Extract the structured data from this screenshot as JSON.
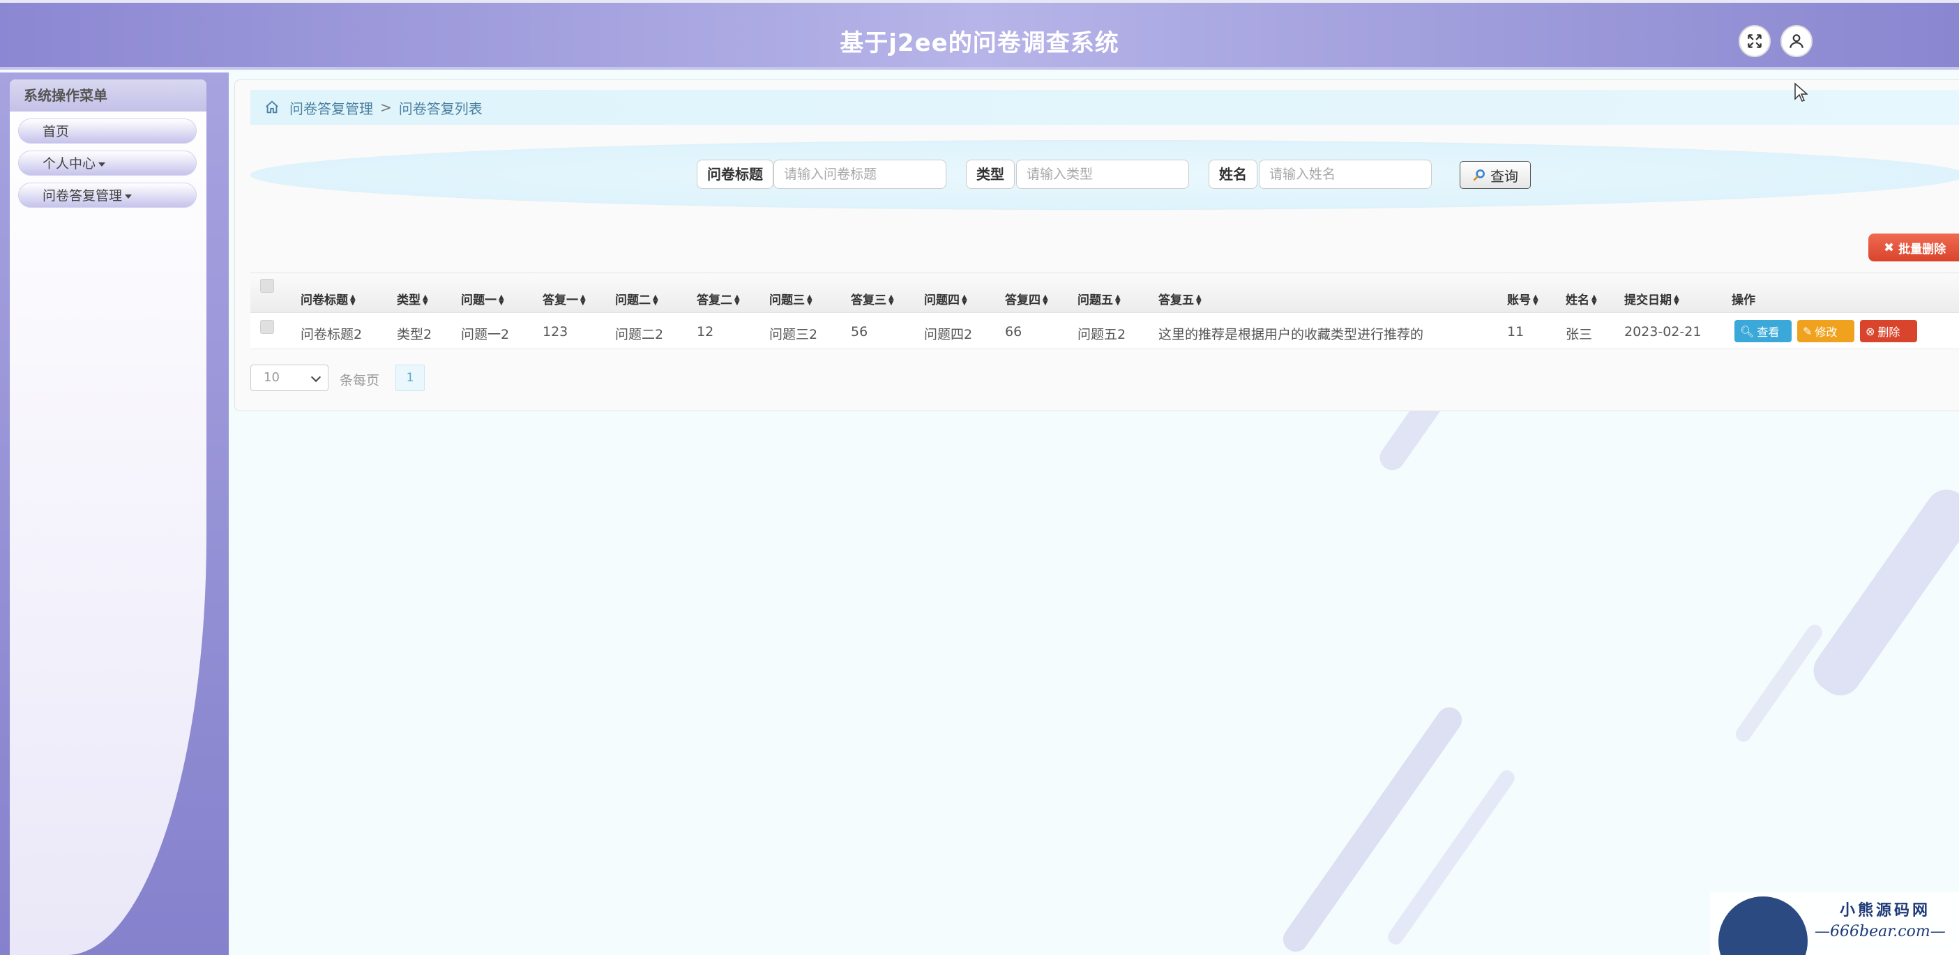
{
  "header": {
    "title": "基于j2ee的问卷调查系统"
  },
  "sidebar": {
    "title": "系统操作菜单",
    "items": [
      {
        "label": "首页",
        "has_caret": false
      },
      {
        "label": "个人中心",
        "has_caret": true
      },
      {
        "label": "问卷答复管理",
        "has_caret": true
      }
    ]
  },
  "breadcrumb": {
    "parent": "问卷答复管理",
    "separator": ">",
    "current": "问卷答复列表"
  },
  "search": {
    "title_label": "问卷标题",
    "title_placeholder": "请输入问卷标题",
    "type_label": "类型",
    "type_placeholder": "请输入类型",
    "name_label": "姓名",
    "name_placeholder": "请输入姓名",
    "query_label": "查询"
  },
  "actions": {
    "batch_delete_label": "批量删除"
  },
  "table": {
    "headers": [
      "问卷标题",
      "类型",
      "问题一",
      "答复一",
      "问题二",
      "答复二",
      "问题三",
      "答复三",
      "问题四",
      "答复四",
      "问题五",
      "答复五",
      "账号",
      "姓名",
      "提交日期",
      "操作"
    ],
    "rows": [
      {
        "cells": [
          "问卷标题2",
          "类型2",
          "问题一2",
          "123",
          "问题二2",
          "12",
          "问题三2",
          "56",
          "问题四2",
          "66",
          "问题五2",
          "这里的推荐是根据用户的收藏类型进行推荐的",
          "11",
          "张三",
          "2023-02-21"
        ],
        "view_label": "查看",
        "edit_label": "修改",
        "delete_label": "删除"
      }
    ]
  },
  "pagination": {
    "page_size": "10",
    "page_size_suffix": "条每页",
    "current_page": "1"
  },
  "watermark": {
    "line1": "小熊源码网",
    "line2": "—666bear.com—"
  },
  "colors": {
    "header_bg": "#a09de0",
    "view": "#3aa9d9",
    "edit": "#f0a21e",
    "delete": "#d9442c"
  },
  "icons": {
    "fullscreen": "expand-arrows-icon",
    "user": "user-icon",
    "home": "home-icon",
    "search": "magnifier-icon"
  }
}
